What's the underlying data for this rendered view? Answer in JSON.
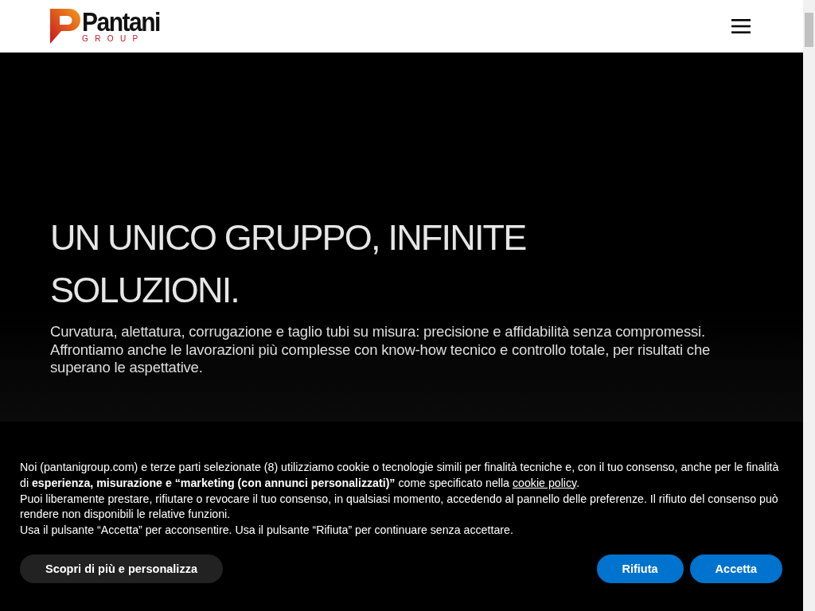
{
  "header": {
    "logo": {
      "name": "Pantani",
      "sub": "GROUP"
    }
  },
  "hero": {
    "title": "UN UNICO GRUPPO, INFINITE SOLUZIONI.",
    "lines": [
      "Curvatura, alettatura, corrugazione e taglio tubi su misura: precisione e affidabilità senza compromessi.",
      "Affrontiamo anche le lavorazioni più complesse con know-how tecnico e controllo totale, per risultati che superano le aspettative."
    ]
  },
  "cookie_banner": {
    "intro": "Noi (pantanigroup.com) e terze parti selezionate (8) utilizziamo cookie o tecnologie simili per finalità tecniche e, con il tuo consenso, anche per le finalità di **esperienza, misurazione e “marketing (con annunci personalizzati)”** come specificato nella",
    "link": "cookie policy",
    "intro_end": ".",
    "paragraphs": [
      "Puoi liberamente prestare, rifiutare o revocare il tuo consenso, in qualsiasi momento, accedendo al pannello delle preferenze. Il rifiuto del consenso può rendere non disponibili le relative funzioni.",
      "Usa il pulsante “Accetta” per acconsentire. Usa il pulsante “Rifiuta” per continuare senza accettare."
    ],
    "buttons": [
      {
        "label": "Scopri di più e personalizza",
        "kind": "secondary"
      },
      {
        "label": "Rifiuta",
        "kind": "primary"
      },
      {
        "label": "Accetta",
        "kind": "primary"
      }
    ]
  }
}
